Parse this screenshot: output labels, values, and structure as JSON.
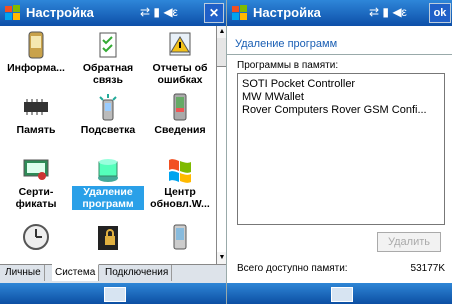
{
  "left": {
    "title": "Настройка",
    "tray": "⇄ ▮ ◀ε",
    "close": "✕",
    "items": [
      {
        "label1": "Информа...",
        "label2": ""
      },
      {
        "label1": "Обратная",
        "label2": "связь"
      },
      {
        "label1": "Отчеты об",
        "label2": "ошибках"
      },
      {
        "label1": "Память",
        "label2": ""
      },
      {
        "label1": "Подсветка",
        "label2": ""
      },
      {
        "label1": "Сведения",
        "label2": ""
      },
      {
        "label1": "Серти-",
        "label2": "фикаты"
      },
      {
        "label1": "Удаление",
        "label2": "программ"
      },
      {
        "label1": "Центр",
        "label2": "обновл.W..."
      }
    ],
    "tabs": [
      "Личные",
      "Система",
      "Подключения"
    ],
    "colors": {
      "titlebar": "#0d4fa8",
      "selected": "#2aa0e8"
    }
  },
  "right": {
    "title": "Настройка",
    "tray": "⇄ ▮ ◀ε",
    "ok": "ok",
    "heading": "Удаление программ",
    "list_label": "Программы в памяти:",
    "programs": [
      "SOTI Pocket Controller",
      "MW MWallet",
      "Rover Computers Rover GSM Confi..."
    ],
    "delete_label": "Удалить",
    "memory_label": "Всего доступно памяти:",
    "memory_value": "53177K"
  }
}
